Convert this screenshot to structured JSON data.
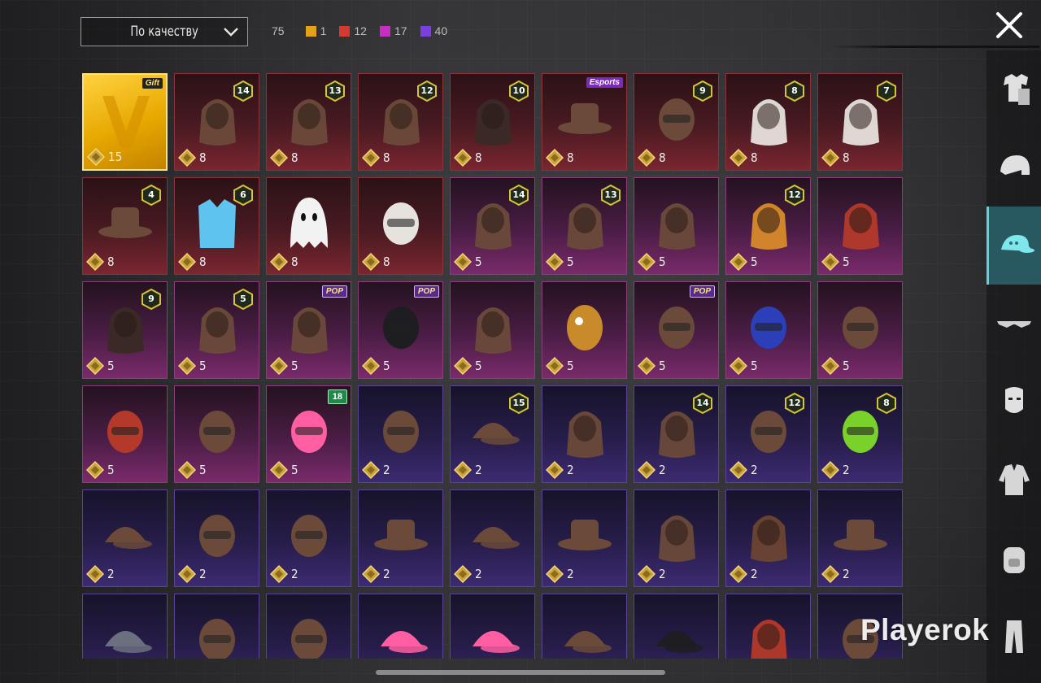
{
  "toolbar": {
    "sort_label": "По качеству",
    "total_count": "75",
    "quality_counts": [
      {
        "color": "#e3a21a",
        "count": "1"
      },
      {
        "color": "#d63a2e",
        "count": "12"
      },
      {
        "color": "#c62fc1",
        "count": "17"
      },
      {
        "color": "#7a3fe0",
        "count": "40"
      }
    ]
  },
  "icons": {
    "close": "close-icon",
    "sort": "chevron-down-icon",
    "currency": "diamond-token-icon"
  },
  "sidebar": {
    "items": [
      {
        "name": "outfit-icon",
        "active": false
      },
      {
        "name": "helmet-icon",
        "active": false
      },
      {
        "name": "cap-icon",
        "active": true
      },
      {
        "name": "glasses-icon",
        "active": false
      },
      {
        "name": "face-mask-icon",
        "active": false
      },
      {
        "name": "jacket-icon",
        "active": false
      },
      {
        "name": "backpack-icon",
        "active": false
      },
      {
        "name": "pants-icon",
        "active": false
      }
    ]
  },
  "items": [
    {
      "rarity": "gold",
      "points": "15",
      "tag": "Gift",
      "art": "gift-box"
    },
    {
      "rarity": "red",
      "points": "8",
      "level": "14",
      "art": "cat-ear-hair"
    },
    {
      "rarity": "red",
      "points": "8",
      "level": "13",
      "art": "hat-hair"
    },
    {
      "rarity": "red",
      "points": "8",
      "level": "12",
      "art": "bunny-hair"
    },
    {
      "rarity": "red",
      "points": "8",
      "level": "10",
      "art": "dark-hair"
    },
    {
      "rarity": "red",
      "points": "8",
      "tag": "Esports",
      "art": "crow-hat"
    },
    {
      "rarity": "red",
      "points": "8",
      "level": "9",
      "art": "zombie-head"
    },
    {
      "rarity": "red",
      "points": "8",
      "level": "8",
      "art": "white-hair"
    },
    {
      "rarity": "red",
      "points": "8",
      "level": "7",
      "art": "long-white-hair"
    },
    {
      "rarity": "red",
      "points": "8",
      "level": "4",
      "art": "snowman-hat"
    },
    {
      "rarity": "red",
      "points": "8",
      "level": "6",
      "art": "ice-vest"
    },
    {
      "rarity": "red",
      "points": "8",
      "art": "ghost"
    },
    {
      "rarity": "red",
      "points": "8",
      "art": "white-cat-head"
    },
    {
      "rarity": "pink",
      "points": "5",
      "level": "14",
      "art": "flower-hair"
    },
    {
      "rarity": "pink",
      "points": "5",
      "level": "13",
      "art": "goggles-hair"
    },
    {
      "rarity": "pink",
      "points": "5",
      "art": "cap-hair"
    },
    {
      "rarity": "pink",
      "points": "5",
      "level": "12",
      "art": "orange-pigtails"
    },
    {
      "rarity": "pink",
      "points": "5",
      "art": "red-bob"
    },
    {
      "rarity": "pink",
      "points": "5",
      "level": "9",
      "art": "dark-long-hair"
    },
    {
      "rarity": "pink",
      "points": "5",
      "level": "5",
      "art": "bow-hair"
    },
    {
      "rarity": "pink",
      "points": "5",
      "tag": "POP",
      "art": "braids"
    },
    {
      "rarity": "pink",
      "points": "5",
      "tag": "POP",
      "art": "black-mask"
    },
    {
      "rarity": "pink",
      "points": "5",
      "art": "crown-hair"
    },
    {
      "rarity": "pink",
      "points": "5",
      "art": "potato-head"
    },
    {
      "rarity": "pink",
      "points": "5",
      "tag": "POP",
      "art": "bunny-mask"
    },
    {
      "rarity": "pink",
      "points": "5",
      "art": "blue-oni"
    },
    {
      "rarity": "pink",
      "points": "5",
      "art": "gas-helmet"
    },
    {
      "rarity": "pink",
      "points": "5",
      "art": "red-mech-helmet"
    },
    {
      "rarity": "pink",
      "points": "5",
      "art": "gold-headdress"
    },
    {
      "rarity": "pink",
      "points": "5",
      "tag": "18",
      "art": "pink-dome"
    },
    {
      "rarity": "purple",
      "points": "2",
      "art": "aviator-helmets"
    },
    {
      "rarity": "purple",
      "points": "2",
      "level": "15",
      "art": "pumpkin-beanie"
    },
    {
      "rarity": "purple",
      "points": "2",
      "art": "visor-hair"
    },
    {
      "rarity": "purple",
      "points": "2",
      "level": "14",
      "art": "cat-cap-hair"
    },
    {
      "rarity": "purple",
      "points": "2",
      "level": "12",
      "art": "bunny-helmet"
    },
    {
      "rarity": "purple",
      "points": "2",
      "level": "8",
      "art": "green-skull"
    },
    {
      "rarity": "purple",
      "points": "2",
      "art": "baseball-cap"
    },
    {
      "rarity": "purple",
      "points": "2",
      "art": "gas-mask-helmet"
    },
    {
      "rarity": "purple",
      "points": "2",
      "art": "moto-helmet"
    },
    {
      "rarity": "purple",
      "points": "2",
      "art": "sun-hat"
    },
    {
      "rarity": "purple",
      "points": "2",
      "art": "beanie"
    },
    {
      "rarity": "purple",
      "points": "2",
      "art": "steampunk-hat"
    },
    {
      "rarity": "purple",
      "points": "2",
      "art": "cyber-braid"
    },
    {
      "rarity": "purple",
      "points": "2",
      "art": "brown-hair"
    },
    {
      "rarity": "purple",
      "points": "2",
      "art": "witch-hat"
    },
    {
      "rarity": "purple",
      "points": "",
      "art": "grey-cap"
    },
    {
      "rarity": "purple",
      "points": "",
      "art": "respirator"
    },
    {
      "rarity": "purple",
      "points": "",
      "art": "turban"
    },
    {
      "rarity": "purple",
      "points": "",
      "art": "pink-trucker-cap"
    },
    {
      "rarity": "purple",
      "points": "",
      "art": "pink-beret"
    },
    {
      "rarity": "purple",
      "points": "",
      "art": "pilot-cap"
    },
    {
      "rarity": "purple",
      "points": "",
      "art": "black-cap"
    },
    {
      "rarity": "purple",
      "points": "",
      "art": "red-hair"
    },
    {
      "rarity": "purple",
      "points": "",
      "art": "football-helmet"
    }
  ],
  "watermark": "Playerok"
}
